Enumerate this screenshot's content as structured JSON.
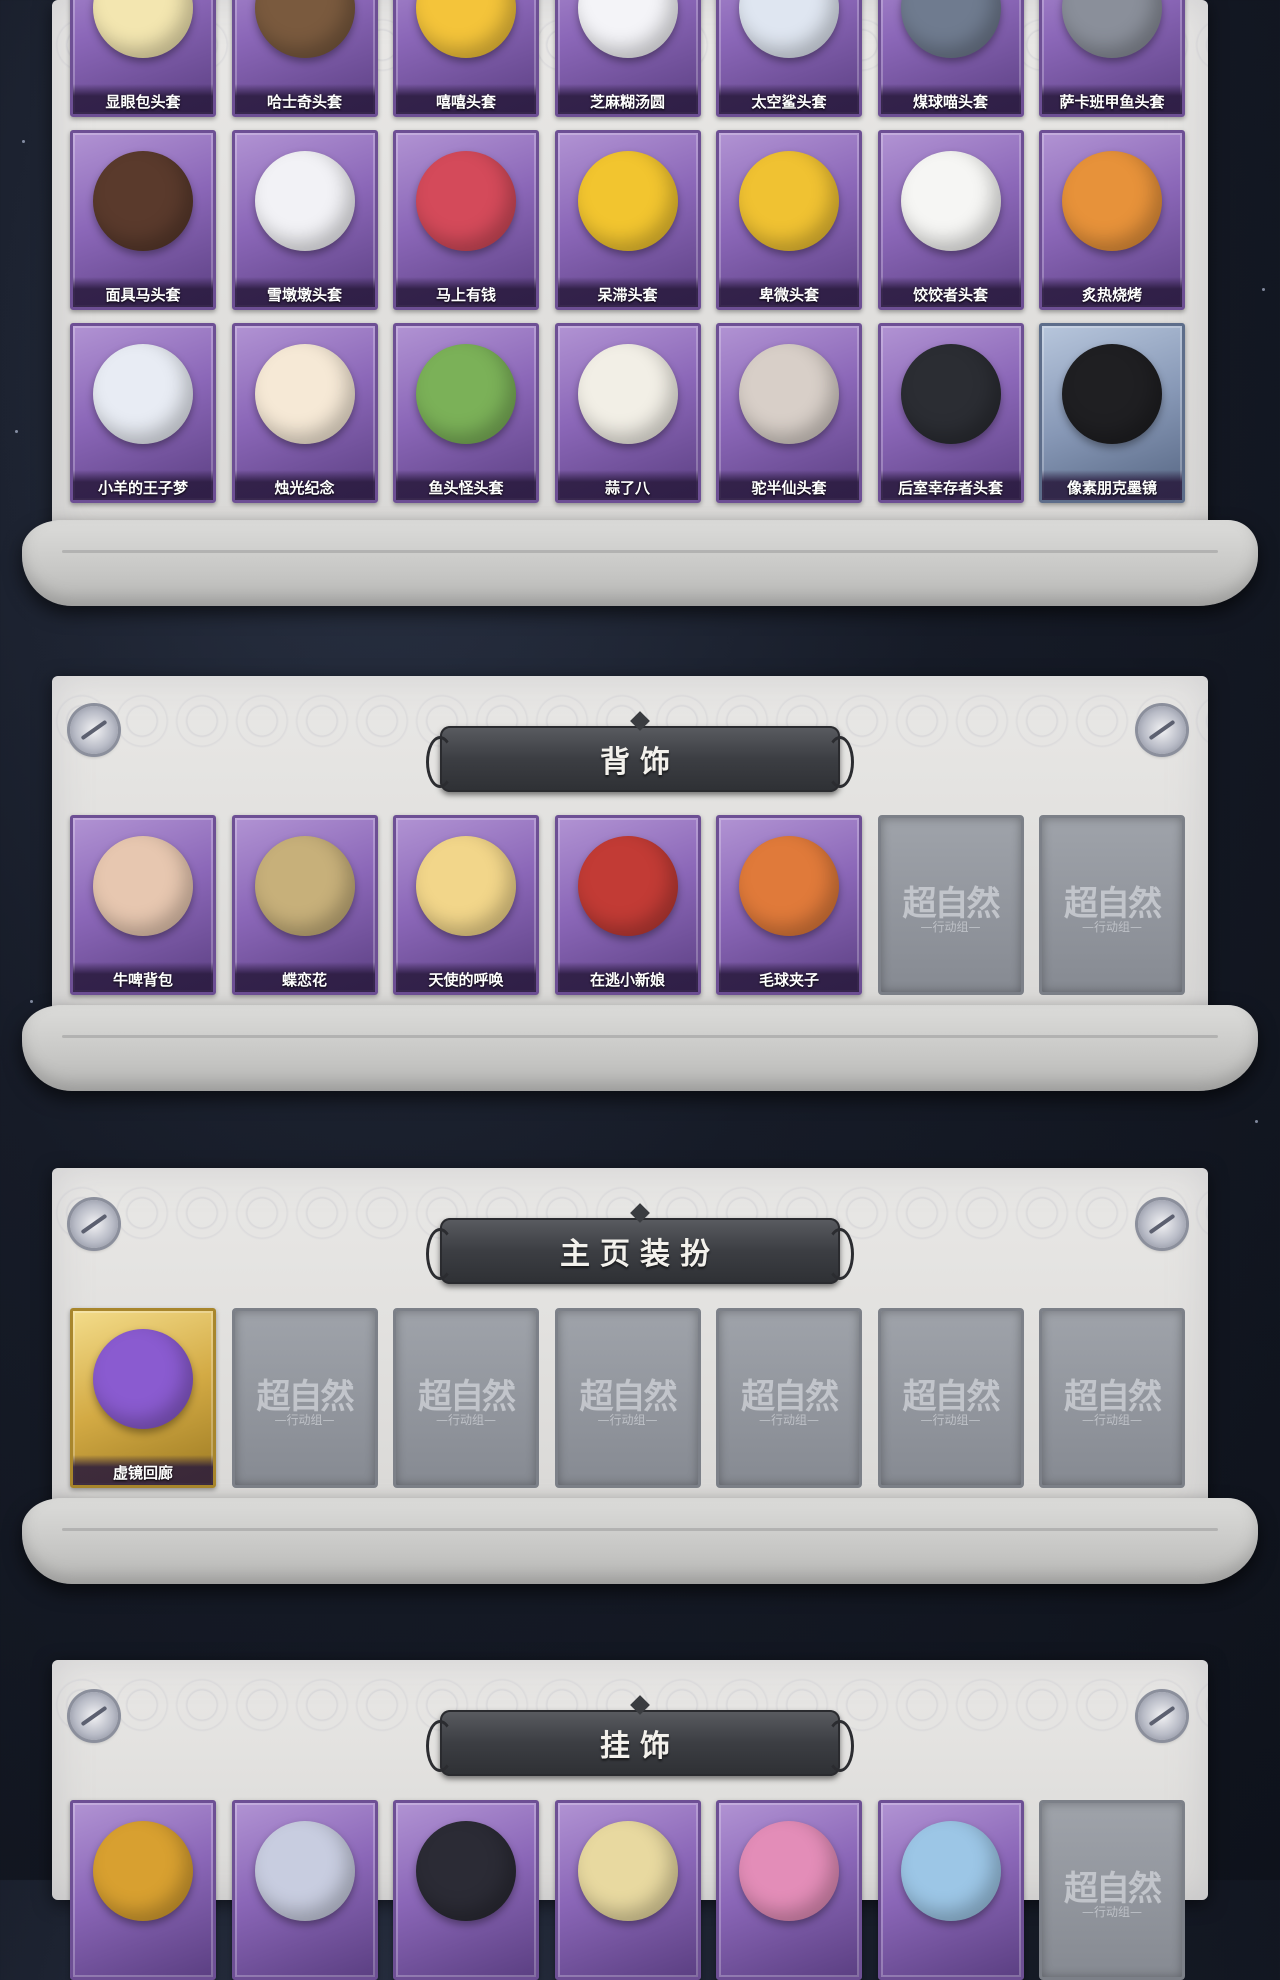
{
  "colors": {
    "background": "#161b27",
    "panel": "#e2e1df",
    "card_purple": "#8b67b8",
    "card_gold": "#d3aa44",
    "card_blue": "#8798b6",
    "banner": "#3c3e43"
  },
  "head_section": {
    "rows": [
      [
        {
          "label": "显眼包头套",
          "art": "#f3e6b0"
        },
        {
          "label": "哈士奇头套",
          "art": "#7a5a3e"
        },
        {
          "label": "嘻嘻头套",
          "art": "#f4c43a"
        },
        {
          "label": "芝麻糊汤圆",
          "art": "#f4f4f8"
        },
        {
          "label": "太空鲨头套",
          "art": "#dfe6f1"
        },
        {
          "label": "煤球喵头套",
          "art": "#6f7b8f"
        },
        {
          "label": "萨卡班甲鱼头套",
          "art": "#8a8f9a"
        }
      ],
      [
        {
          "label": "面具马头套",
          "art": "#5a3a2c"
        },
        {
          "label": "雪墩墩头套",
          "art": "#f2f2f6"
        },
        {
          "label": "马上有钱",
          "art": "#d44a5a"
        },
        {
          "label": "呆滞头套",
          "art": "#f2c52f"
        },
        {
          "label": "卑微头套",
          "art": "#f0c232"
        },
        {
          "label": "饺饺者头套",
          "art": "#f6f6f4"
        },
        {
          "label": "炙热烧烤",
          "art": "#e7923a"
        }
      ],
      [
        {
          "label": "小羊的王子梦",
          "art": "#e8ecf4"
        },
        {
          "label": "烛光纪念",
          "art": "#f6e9d6"
        },
        {
          "label": "鱼头怪头套",
          "art": "#7bb158"
        },
        {
          "label": "蒜了八",
          "art": "#f2efe6"
        },
        {
          "label": "驼半仙头套",
          "art": "#d8cfc8"
        },
        {
          "label": "后室幸存者头套",
          "art": "#2b2d33"
        },
        {
          "label": "像素朋克墨镜",
          "art": "#1f1f22"
        }
      ]
    ]
  },
  "back_section": {
    "title": "背饰",
    "items": [
      {
        "label": "牛啤背包",
        "art": "#e7c7b0"
      },
      {
        "label": "蝶恋花",
        "art": "#c7b07a"
      },
      {
        "label": "天使的呼唤",
        "art": "#f2d68a"
      },
      {
        "label": "在逃小新娘",
        "art": "#c23b35"
      },
      {
        "label": "毛球夹子",
        "art": "#e07a3a"
      }
    ],
    "placeholders": 2
  },
  "home_section": {
    "title": "主页装扮",
    "items": [
      {
        "label": "虚镜回廊",
        "art": "#8a5bd0"
      }
    ],
    "placeholders": 6
  },
  "pendant_section": {
    "title": "挂饰",
    "items": [
      {
        "label": "",
        "art": "#d8a030"
      },
      {
        "label": "",
        "art": "#c8cde0"
      },
      {
        "label": "",
        "art": "#2b2b35"
      },
      {
        "label": "",
        "art": "#e8d9a0"
      },
      {
        "label": "",
        "art": "#e38db8"
      },
      {
        "label": "",
        "art": "#9cc6e6"
      }
    ],
    "placeholders": 1
  },
  "placeholder_logo": {
    "main": "超自然",
    "sub": "—行动组—"
  }
}
